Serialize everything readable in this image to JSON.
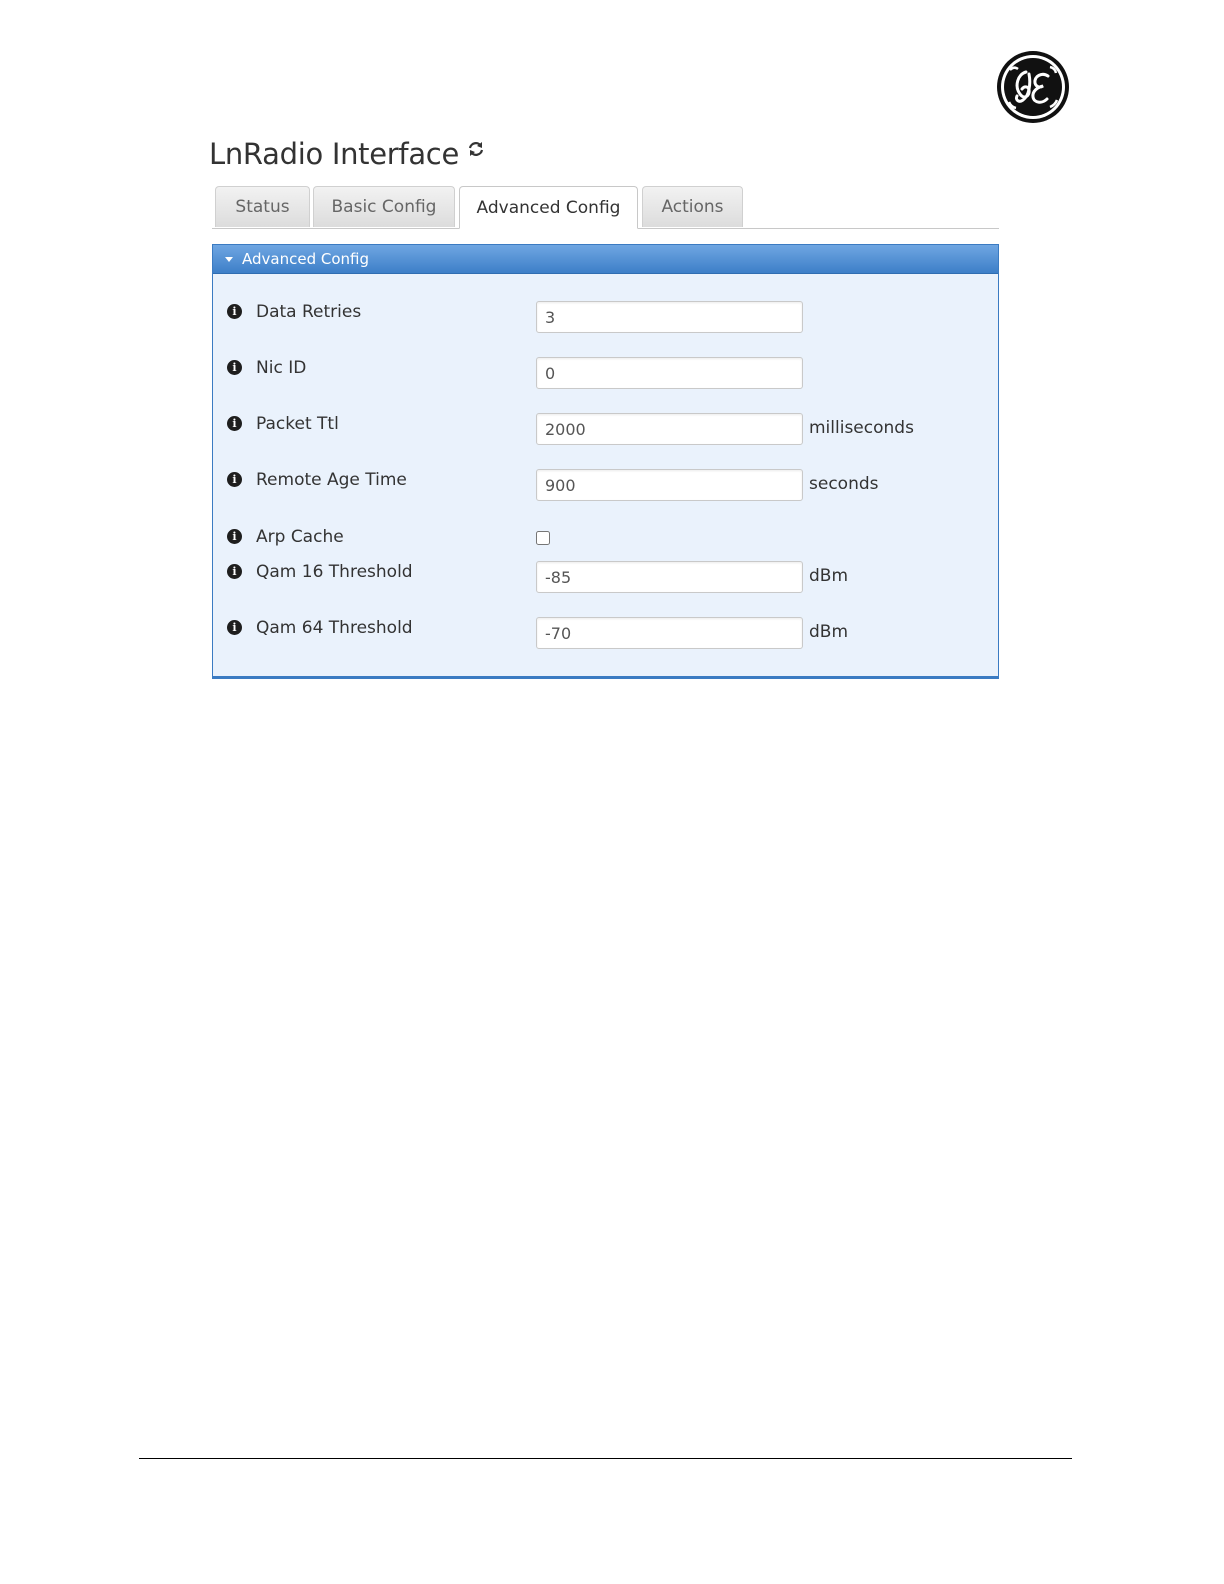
{
  "page": {
    "title": "LnRadio Interface",
    "accent_color": "#3d7fc8"
  },
  "tabs": [
    {
      "label": "Status",
      "active": false
    },
    {
      "label": "Basic Config",
      "active": false
    },
    {
      "label": "Advanced Config",
      "active": true
    },
    {
      "label": "Actions",
      "active": false
    }
  ],
  "panel": {
    "title": "Advanced Config",
    "fields": [
      {
        "label": "Data Retries",
        "value": "3",
        "unit": ""
      },
      {
        "label": "Nic ID",
        "value": "0",
        "unit": ""
      },
      {
        "label": "Packet Ttl",
        "value": "2000",
        "unit": "milliseconds"
      },
      {
        "label": "Remote Age Time",
        "value": "900",
        "unit": "seconds"
      },
      {
        "label": "Arp Cache",
        "checked": false
      },
      {
        "label": "Qam 16 Threshold",
        "value": "-85",
        "unit": "dBm"
      },
      {
        "label": "Qam 64 Threshold",
        "value": "-70",
        "unit": "dBm"
      }
    ]
  },
  "icons": {
    "logo": "ge-logo",
    "refresh": "refresh-icon",
    "info": "info-icon",
    "collapse": "caret-down-icon"
  }
}
